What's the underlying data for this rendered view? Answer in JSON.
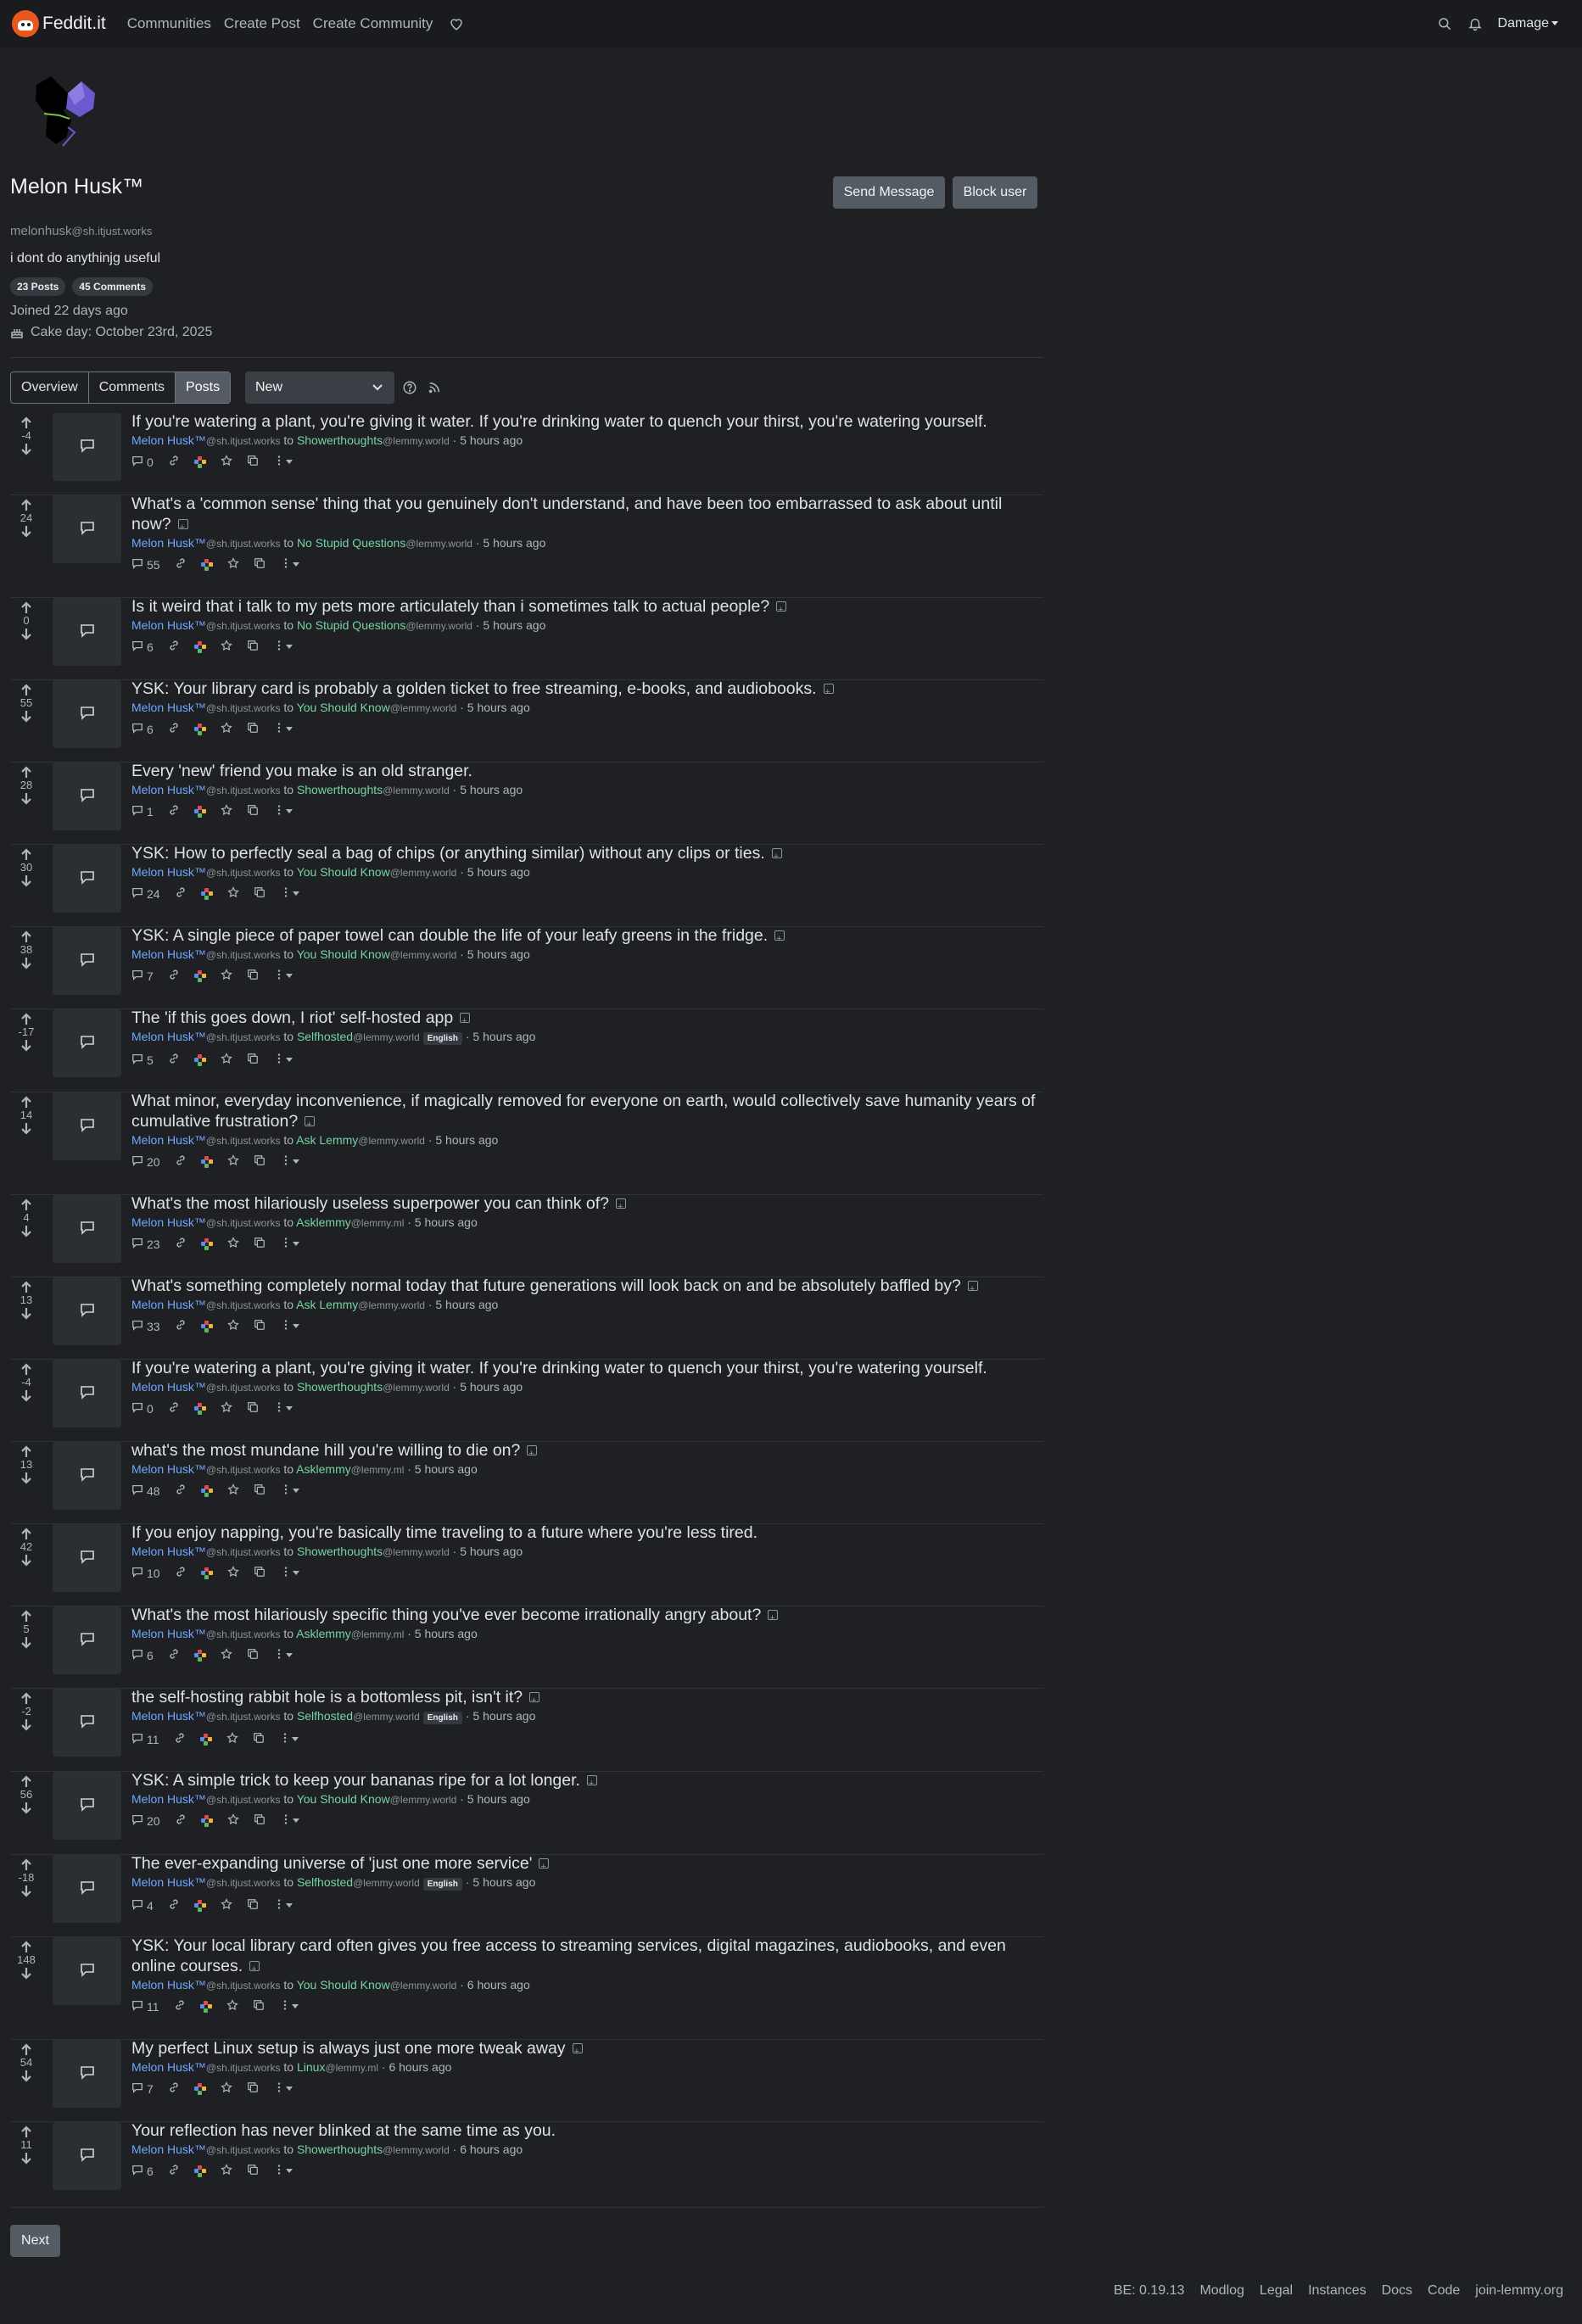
{
  "app": {
    "brand": "Feddit.it"
  },
  "nav": {
    "links": [
      "Communities",
      "Create Post",
      "Create Community"
    ],
    "user": "Damage"
  },
  "profile": {
    "display_name": "Melon Husk™",
    "username": "melonhusk",
    "instance": "@sh.itjust.works",
    "bio": "i dont do anythinjg useful",
    "posts_badge": "23 Posts",
    "comments_badge": "45 Comments",
    "joined": "Joined 22 days ago",
    "cake_day": "Cake day: October 23rd, 2025",
    "send_message": "Send Message",
    "block_user": "Block user"
  },
  "views": {
    "overview": "Overview",
    "comments": "Comments",
    "posts": "Posts",
    "active": "Posts"
  },
  "sort": {
    "selected": "New"
  },
  "posts": [
    {
      "score": "-4",
      "title": "If you're watering a plant, you're giving it water. If you're drinking water to quench your thirst, you're watering yourself.",
      "author": "Melon Husk™",
      "author_instance": "@sh.itjust.works",
      "to": "to",
      "community": "Showerthoughts",
      "community_instance": "@lemmy.world",
      "lang": "",
      "time": "· 5 hours ago",
      "comments": "0"
    },
    {
      "score": "24",
      "title": "What's a 'common sense' thing that you genuinely don't understand, and have been too embarrassed to ask about until now?",
      "author": "Melon Husk™",
      "author_instance": "@sh.itjust.works",
      "to": "to",
      "community": "No Stupid Questions",
      "community_instance": "@lemmy.world",
      "lang": "",
      "time": "· 5 hours ago",
      "comments": "55"
    },
    {
      "score": "0",
      "title": "Is it weird that i talk to my pets more articulately than i sometimes talk to actual people?",
      "author": "Melon Husk™",
      "author_instance": "@sh.itjust.works",
      "to": "to",
      "community": "No Stupid Questions",
      "community_instance": "@lemmy.world",
      "lang": "",
      "time": "· 5 hours ago",
      "comments": "6"
    },
    {
      "score": "55",
      "title": "YSK: Your library card is probably a golden ticket to free streaming, e-books, and audiobooks.",
      "author": "Melon Husk™",
      "author_instance": "@sh.itjust.works",
      "to": "to",
      "community": "You Should Know",
      "community_instance": "@lemmy.world",
      "lang": "",
      "time": "· 5 hours ago",
      "comments": "6"
    },
    {
      "score": "28",
      "title": "Every 'new' friend you make is an old stranger.",
      "author": "Melon Husk™",
      "author_instance": "@sh.itjust.works",
      "to": "to",
      "community": "Showerthoughts",
      "community_instance": "@lemmy.world",
      "lang": "",
      "time": "· 5 hours ago",
      "comments": "1"
    },
    {
      "score": "30",
      "title": "YSK: How to perfectly seal a bag of chips (or anything similar) without any clips or ties.",
      "author": "Melon Husk™",
      "author_instance": "@sh.itjust.works",
      "to": "to",
      "community": "You Should Know",
      "community_instance": "@lemmy.world",
      "lang": "",
      "time": "· 5 hours ago",
      "comments": "24"
    },
    {
      "score": "38",
      "title": "YSK: A single piece of paper towel can double the life of your leafy greens in the fridge.",
      "author": "Melon Husk™",
      "author_instance": "@sh.itjust.works",
      "to": "to",
      "community": "You Should Know",
      "community_instance": "@lemmy.world",
      "lang": "",
      "time": "· 5 hours ago",
      "comments": "7"
    },
    {
      "score": "-17",
      "title": "The 'if this goes down, I riot' self-hosted app",
      "author": "Melon Husk™",
      "author_instance": "@sh.itjust.works",
      "to": "to",
      "community": "Selfhosted",
      "community_instance": "@lemmy.world",
      "lang": "English",
      "time": "· 5 hours ago",
      "comments": "5"
    },
    {
      "score": "14",
      "title": "What minor, everyday inconvenience, if magically removed for everyone on earth, would collectively save humanity years of cumulative frustration?",
      "author": "Melon Husk™",
      "author_instance": "@sh.itjust.works",
      "to": "to",
      "community": "Ask Lemmy",
      "community_instance": "@lemmy.world",
      "lang": "",
      "time": "· 5 hours ago",
      "comments": "20"
    },
    {
      "score": "4",
      "title": "What's the most hilariously useless superpower you can think of?",
      "author": "Melon Husk™",
      "author_instance": "@sh.itjust.works",
      "to": "to",
      "community": "Asklemmy",
      "community_instance": "@lemmy.ml",
      "lang": "",
      "time": "· 5 hours ago",
      "comments": "23"
    },
    {
      "score": "13",
      "title": "What's something completely normal today that future generations will look back on and be absolutely baffled by?",
      "author": "Melon Husk™",
      "author_instance": "@sh.itjust.works",
      "to": "to",
      "community": "Ask Lemmy",
      "community_instance": "@lemmy.world",
      "lang": "",
      "time": "· 5 hours ago",
      "comments": "33"
    },
    {
      "score": "-4",
      "title": "If you're watering a plant, you're giving it water. If you're drinking water to quench your thirst, you're watering yourself.",
      "author": "Melon Husk™",
      "author_instance": "@sh.itjust.works",
      "to": "to",
      "community": "Showerthoughts",
      "community_instance": "@lemmy.world",
      "lang": "",
      "time": "· 5 hours ago",
      "comments": "0"
    },
    {
      "score": "13",
      "title": "what's the most mundane hill you're willing to die on?",
      "author": "Melon Husk™",
      "author_instance": "@sh.itjust.works",
      "to": "to",
      "community": "Asklemmy",
      "community_instance": "@lemmy.ml",
      "lang": "",
      "time": "· 5 hours ago",
      "comments": "48"
    },
    {
      "score": "42",
      "title": "If you enjoy napping, you're basically time traveling to a future where you're less tired.",
      "author": "Melon Husk™",
      "author_instance": "@sh.itjust.works",
      "to": "to",
      "community": "Showerthoughts",
      "community_instance": "@lemmy.world",
      "lang": "",
      "time": "· 5 hours ago",
      "comments": "10"
    },
    {
      "score": "5",
      "title": "What's the most hilariously specific thing you've ever become irrationally angry about?",
      "author": "Melon Husk™",
      "author_instance": "@sh.itjust.works",
      "to": "to",
      "community": "Asklemmy",
      "community_instance": "@lemmy.ml",
      "lang": "",
      "time": "· 5 hours ago",
      "comments": "6"
    },
    {
      "score": "-2",
      "title": "the self-hosting rabbit hole is a bottomless pit, isn't it?",
      "author": "Melon Husk™",
      "author_instance": "@sh.itjust.works",
      "to": "to",
      "community": "Selfhosted",
      "community_instance": "@lemmy.world",
      "lang": "English",
      "time": "· 5 hours ago",
      "comments": "11"
    },
    {
      "score": "56",
      "title": "YSK: A simple trick to keep your bananas ripe for a lot longer.",
      "author": "Melon Husk™",
      "author_instance": "@sh.itjust.works",
      "to": "to",
      "community": "You Should Know",
      "community_instance": "@lemmy.world",
      "lang": "",
      "time": "· 5 hours ago",
      "comments": "20"
    },
    {
      "score": "-18",
      "title": "The ever-expanding universe of 'just one more service'",
      "author": "Melon Husk™",
      "author_instance": "@sh.itjust.works",
      "to": "to",
      "community": "Selfhosted",
      "community_instance": "@lemmy.world",
      "lang": "English",
      "time": "· 5 hours ago",
      "comments": "4"
    },
    {
      "score": "148",
      "title": "YSK: Your local library card often gives you free access to streaming services, digital magazines, audiobooks, and even online courses.",
      "author": "Melon Husk™",
      "author_instance": "@sh.itjust.works",
      "to": "to",
      "community": "You Should Know",
      "community_instance": "@lemmy.world",
      "lang": "",
      "time": "· 6 hours ago",
      "comments": "11"
    },
    {
      "score": "54",
      "title": "My perfect Linux setup is always just one more tweak away",
      "author": "Melon Husk™",
      "author_instance": "@sh.itjust.works",
      "to": "to",
      "community": "Linux",
      "community_instance": "@lemmy.ml",
      "lang": "",
      "time": "· 6 hours ago",
      "comments": "7"
    },
    {
      "score": "11",
      "title": "Your reflection has never blinked at the same time as you.",
      "author": "Melon Husk™",
      "author_instance": "@sh.itjust.works",
      "to": "to",
      "community": "Showerthoughts",
      "community_instance": "@lemmy.world",
      "lang": "",
      "time": "· 6 hours ago",
      "comments": "6"
    }
  ],
  "pagination": {
    "next": "Next"
  },
  "footer": {
    "links": [
      "BE: 0.19.13",
      "Modlog",
      "Legal",
      "Instances",
      "Docs",
      "Code",
      "join-lemmy.org"
    ]
  },
  "colors": {
    "background": "#1f2023",
    "link_user": "#6ea8fe",
    "link_community": "#75d3a5",
    "button": "#555b63"
  }
}
